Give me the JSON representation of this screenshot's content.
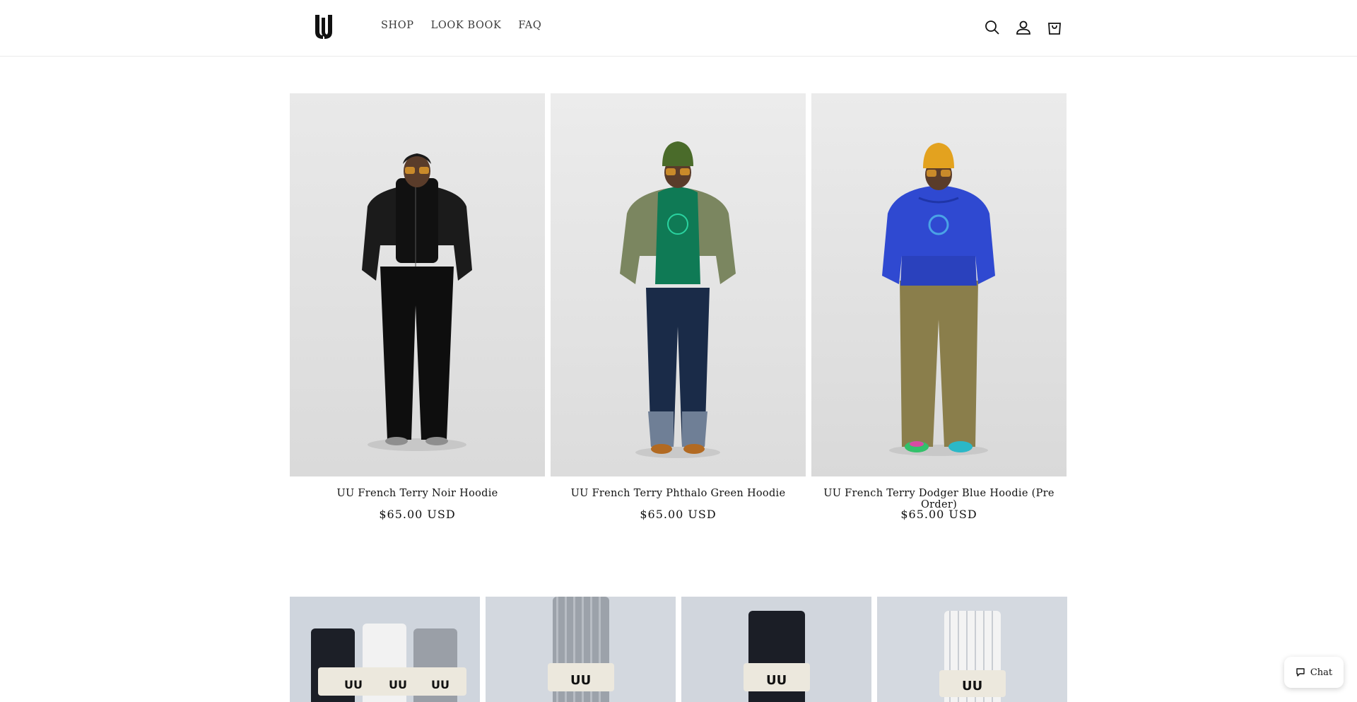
{
  "header": {
    "logo_alt": "UU",
    "nav": [
      "SHOP",
      "LOOK BOOK",
      "FAQ"
    ],
    "icons": [
      "search-icon",
      "account-icon",
      "cart-icon"
    ]
  },
  "products": [
    {
      "title": "UU French Terry Noir Hoodie",
      "price": "$65.00 USD",
      "hoodie_color": "#141414",
      "hat_color": "",
      "pants_color": "#0e0e0e"
    },
    {
      "title": "UU French Terry Phthalo Green Hoodie",
      "price": "$65.00 USD",
      "hoodie_color": "#0f7a55",
      "hat_color": "#4a6b2a",
      "pants_color": "#1a2b48"
    },
    {
      "title": "UU French Terry Dodger Blue Hoodie (Pre Order)",
      "price": "$65.00 USD",
      "hoodie_color": "#2f49d1",
      "hat_color": "#e3a21f",
      "pants_color": "#8a7e4b"
    }
  ],
  "socks_row": {
    "items": [
      "socks-trio",
      "socks-grey",
      "socks-black",
      "socks-white"
    ]
  },
  "chat": {
    "label": "Chat"
  }
}
